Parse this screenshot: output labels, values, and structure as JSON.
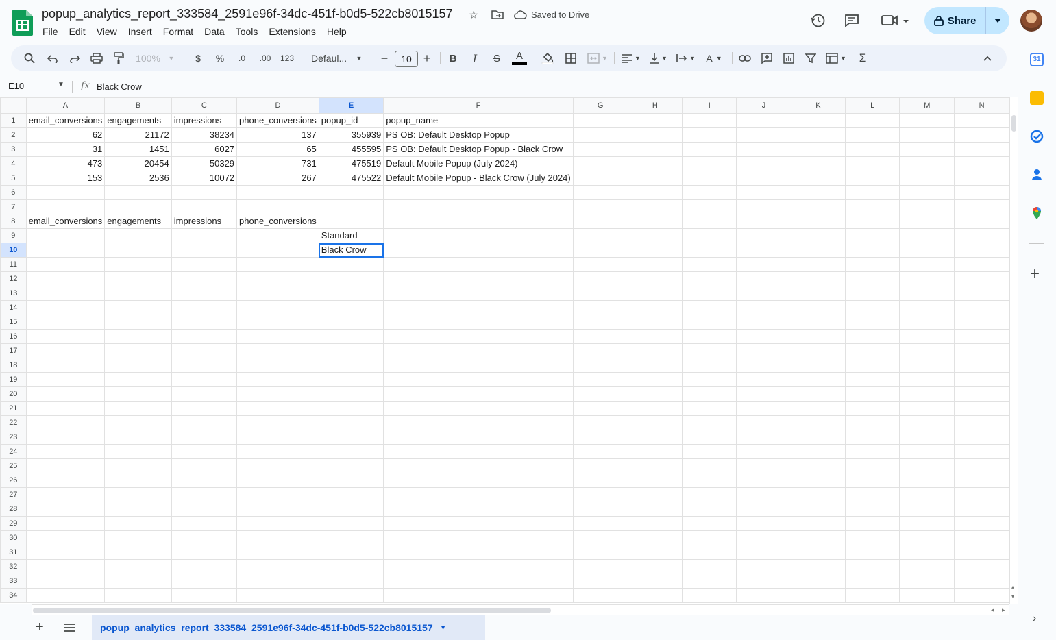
{
  "app": {
    "title": "popup_analytics_report_333584_2591e96f-34dc-451f-b0d5-522cb8015157",
    "saved_status": "Saved to Drive",
    "share_label": "Share"
  },
  "menu": [
    "File",
    "Edit",
    "View",
    "Insert",
    "Format",
    "Data",
    "Tools",
    "Extensions",
    "Help"
  ],
  "toolbar": {
    "zoom": "100%",
    "currency": "$",
    "percent": "%",
    "decrease_decimal": ".0",
    "increase_decimal": ".00",
    "number_format": "123",
    "font": "Defaul...",
    "font_size": "10",
    "bold": "B",
    "italic": "I",
    "strike": "S",
    "text_color": "A",
    "sum": "Σ"
  },
  "formula_bar": {
    "cell_ref": "E10",
    "fx": "fx",
    "value": "Black Crow"
  },
  "columns": [
    "A",
    "B",
    "C",
    "D",
    "E",
    "F",
    "G",
    "H",
    "I",
    "J",
    "K",
    "L",
    "M",
    "N"
  ],
  "selected_cell": {
    "col": "E",
    "row": 10
  },
  "rows": [
    [
      "email_conversions",
      "engagements",
      "impressions",
      "phone_conversions",
      "popup_id",
      "popup_name",
      "",
      "",
      "",
      "",
      "",
      "",
      "",
      ""
    ],
    [
      "62",
      "21172",
      "38234",
      "137",
      "355939",
      "PS OB: Default Desktop Popup",
      "",
      "",
      "",
      "",
      "",
      "",
      "",
      ""
    ],
    [
      "31",
      "1451",
      "6027",
      "65",
      "455595",
      "PS OB: Default Desktop Popup - Black Crow",
      "",
      "",
      "",
      "",
      "",
      "",
      "",
      ""
    ],
    [
      "473",
      "20454",
      "50329",
      "731",
      "475519",
      "Default Mobile Popup (July 2024)",
      "",
      "",
      "",
      "",
      "",
      "",
      "",
      ""
    ],
    [
      "153",
      "2536",
      "10072",
      "267",
      "475522",
      "Default Mobile Popup - Black Crow (July 2024)",
      "",
      "",
      "",
      "",
      "",
      "",
      "",
      ""
    ],
    [
      "",
      "",
      "",
      "",
      "",
      "",
      "",
      "",
      "",
      "",
      "",
      "",
      "",
      ""
    ],
    [
      "",
      "",
      "",
      "",
      "",
      "",
      "",
      "",
      "",
      "",
      "",
      "",
      "",
      ""
    ],
    [
      "email_conversions",
      "engagements",
      "impressions",
      "phone_conversions",
      "",
      "",
      "",
      "",
      "",
      "",
      "",
      "",
      "",
      ""
    ],
    [
      "",
      "",
      "",
      "",
      "Standard",
      "",
      "",
      "",
      "",
      "",
      "",
      "",
      "",
      ""
    ],
    [
      "",
      "",
      "",
      "",
      "Black Crow",
      "",
      "",
      "",
      "",
      "",
      "",
      "",
      "",
      ""
    ]
  ],
  "row_count": 34,
  "sheet_tabs": [
    {
      "name": "popup_analytics_report_333584_2591e96f-34dc-451f-b0d5-522cb8015157",
      "active": true
    }
  ],
  "colors": {
    "accent": "#0b57d0",
    "share_bg": "#c2e7ff",
    "sheets_green": "#0f9d58",
    "selection_outline": "#1a73e8"
  }
}
